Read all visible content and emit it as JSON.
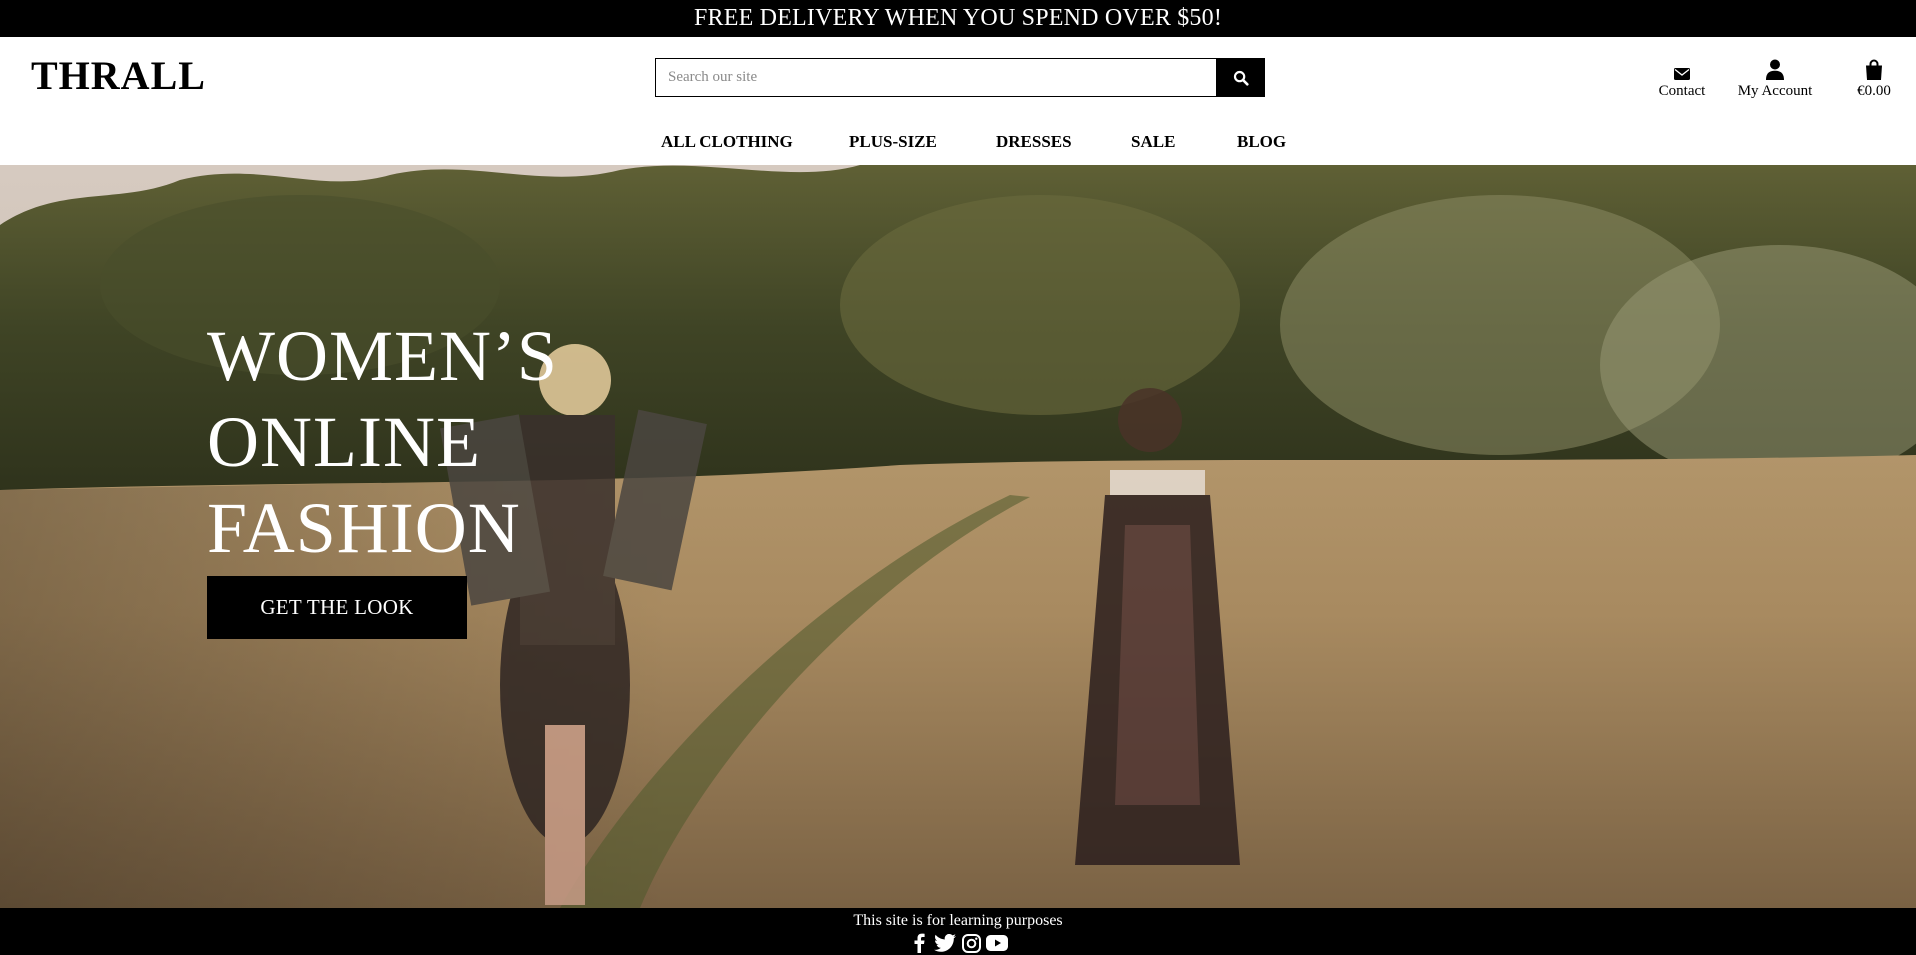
{
  "promo": {
    "text": "FREE DELIVERY WHEN YOU SPEND OVER $50!"
  },
  "header": {
    "brand": "THRALL",
    "search": {
      "placeholder": "Search our site",
      "value": "",
      "icon": "search-icon"
    },
    "links": [
      {
        "label": "Contact",
        "icon": "envelope-icon"
      },
      {
        "label": "My Account",
        "icon": "user-icon"
      },
      {
        "label": "€0.00",
        "icon": "shopping-bag-icon"
      }
    ]
  },
  "nav": {
    "items": [
      "ALL CLOTHING",
      "PLUS-SIZE",
      "DRESSES",
      "SALE",
      "BLOG"
    ]
  },
  "hero": {
    "title_lines": [
      "WOMEN’S",
      "ONLINE",
      "FASHION"
    ],
    "cta_label": "GET THE LOOK"
  },
  "footer": {
    "note": "This site is for learning purposes",
    "social": [
      "facebook-icon",
      "twitter-icon",
      "instagram-icon",
      "youtube-icon"
    ]
  },
  "colors": {
    "bar": "#000000",
    "text_on_dark": "#ffffff",
    "page": "#ffffff"
  }
}
